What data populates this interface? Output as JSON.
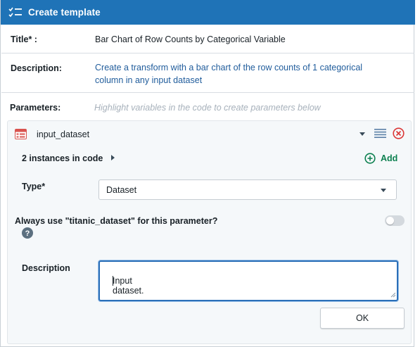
{
  "header": {
    "title": "Create template",
    "icon": "checklist-icon",
    "bg": "#1f73b7"
  },
  "fields": {
    "title_label": "Title* :",
    "title_value": "Bar Chart of Row Counts by Categorical Variable",
    "description_label": "Description:",
    "description_line1": "Create a transform with a bar chart of the row counts of 1 categorical",
    "description_line2": "column in any input dataset",
    "parameters_label": "Parameters:",
    "parameters_hint": "Highlight variables in the code to create parameters below"
  },
  "parameter": {
    "name": "input_dataset",
    "icon": "table-icon",
    "instances": "2 instances in code",
    "add_label": "Add",
    "type_label": "Type*",
    "type_value": "Dataset",
    "always_use_label": "Always use \"titanic_dataset\" for this parameter?",
    "always_use_enabled": false,
    "description_label": "Description",
    "description_value": "Input dataset.",
    "ok_label": "OK"
  },
  "colors": {
    "accent": "#1f73b7",
    "link": "#215d9c",
    "add_green": "#0d8050",
    "remove_red": "#db3737"
  }
}
